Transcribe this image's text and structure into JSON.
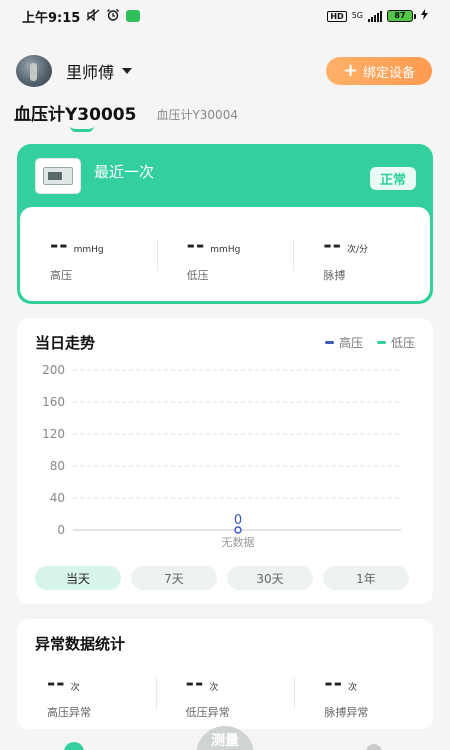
{
  "status_bar": {
    "time": "上午9:15",
    "network": "5G",
    "battery": "87"
  },
  "header": {
    "user_name": "里师傅",
    "bind_button": "绑定设备"
  },
  "device_tabs": {
    "active": "血压计Y30005",
    "other": "血压计Y30004"
  },
  "latest": {
    "title": "最近一次",
    "status": "正常",
    "metrics": [
      {
        "value": "--",
        "unit": "mmHg",
        "label": "高压"
      },
      {
        "value": "--",
        "unit": "mmHg",
        "label": "低压"
      },
      {
        "value": "--",
        "unit": "次/分",
        "label": "脉搏"
      }
    ]
  },
  "trend": {
    "title": "当日走势",
    "legend": [
      {
        "name": "高压",
        "color": "#3b5bb5"
      },
      {
        "name": "低压",
        "color": "#33cf9e"
      }
    ],
    "range_tabs": [
      "当天",
      "7天",
      "30天",
      "1年"
    ],
    "active_range": "当天"
  },
  "chart_data": {
    "type": "line",
    "yticks": [
      200,
      160,
      120,
      80,
      40,
      0
    ],
    "ylim": [
      0,
      200
    ],
    "series": [
      {
        "name": "高压",
        "values": []
      },
      {
        "name": "低压",
        "values": []
      }
    ],
    "point_label": "0",
    "empty_text": "无数据"
  },
  "abnormal": {
    "title": "异常数据统计",
    "metrics": [
      {
        "value": "--",
        "unit": "次",
        "label": "高压异常"
      },
      {
        "value": "--",
        "unit": "次",
        "label": "低压异常"
      },
      {
        "value": "--",
        "unit": "次",
        "label": "脉搏异常"
      }
    ]
  },
  "bottom_nav": {
    "center_label": "测量"
  },
  "colors": {
    "accent": "#33cf9e",
    "orange": "#ff9a50",
    "systolic": "#3b5bb5"
  }
}
